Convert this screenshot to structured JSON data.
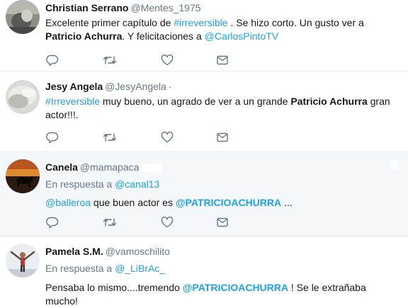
{
  "tweets": [
    {
      "fullname": "Christian Serrano",
      "username": "@Mentes_1975",
      "text_parts": [
        "Excelente primer capítulo de ",
        "#irreversible",
        " . Se hizo corto. Un gusto ver a ",
        "Patricio Achurra",
        ". Y felicitaciones a ",
        "@CarlosPintoTV"
      ]
    },
    {
      "fullname": "Jesy Angela",
      "username": "@JesyAngela",
      "dot": "·",
      "text_parts": [
        "#Irreversible",
        " muy bueno, un agrado de ver a un grande ",
        "Patricio Achurra",
        " gran actor!!!."
      ]
    },
    {
      "fullname": "Canela",
      "username": "@mamapaca",
      "reply_prefix": "En respuesta a ",
      "reply_to": "@canal13",
      "text_parts": [
        "@balleroa",
        " que buen actor es ",
        "@PATRICIOACHURRA",
        " ..."
      ]
    },
    {
      "fullname": "Pamela S.M.",
      "username": "@vamoschilito",
      "reply_prefix": "En respuesta a ",
      "reply_to": "@_LiBrAc_",
      "text_parts": [
        "Pensaba lo mismo....tremendo ",
        "@PATRICIOACHURRA",
        " !  Se le extrañaba mucho!"
      ]
    }
  ],
  "icons": [
    "reply-icon",
    "retweet-icon",
    "like-icon",
    "message-icon"
  ],
  "colors": {
    "link": "#1da1f2",
    "muted": "#657786",
    "text": "#14171a",
    "highlight_bg": "#f5f8fa"
  }
}
